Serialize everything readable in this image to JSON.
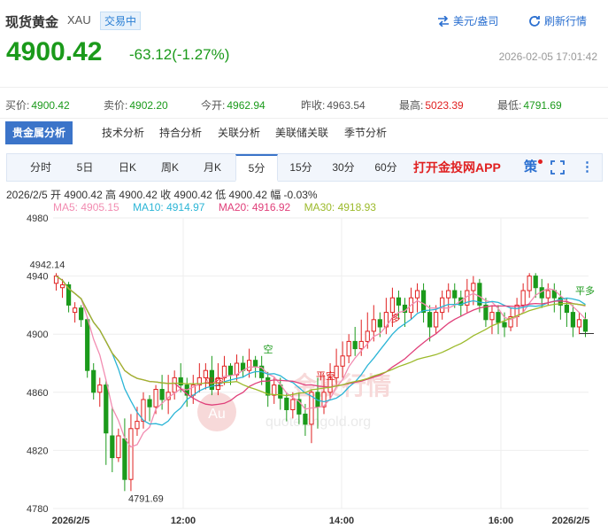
{
  "header": {
    "title": "现货黄金",
    "symbol": "XAU",
    "status": "交易中",
    "currency_link": "美元/盎司",
    "refresh_link": "刷新行情",
    "price": "4900.42",
    "change": "-63.12(-1.27%)",
    "timestamp": "2026-02-05 17:01:42"
  },
  "quotes": [
    {
      "label": "买价:",
      "value": "4900.42",
      "color": "green"
    },
    {
      "label": "卖价:",
      "value": "4902.20",
      "color": "green"
    },
    {
      "label": "今开:",
      "value": "4962.94",
      "color": "green"
    },
    {
      "label": "昨收:",
      "value": "4963.54",
      "color": "neutral"
    },
    {
      "label": "最高:",
      "value": "5023.39",
      "color": "red"
    },
    {
      "label": "最低:",
      "value": "4791.69",
      "color": "green"
    }
  ],
  "analysis_tabs": [
    "贵金属分析",
    "技术分析",
    "持合分析",
    "关联分析",
    "美联储关联",
    "季节分析"
  ],
  "period_tabs": [
    "分时",
    "5日",
    "日K",
    "周K",
    "月K",
    "5分",
    "15分",
    "30分",
    "60分"
  ],
  "active_period": "5分",
  "app_banner": "打开金投网APP",
  "strategy_label": "策",
  "ohlc_info": "2026/2/5  开 4900.42  高 4900.42  收 4900.42  低 4900.42  幅 -0.03%",
  "ma_legend": [
    {
      "label": "MA5: 4905.15",
      "color": "#f28cb1"
    },
    {
      "label": "MA10: 4914.97",
      "color": "#2bb5d6"
    },
    {
      "label": "MA20: 4916.92",
      "color": "#e0407a"
    },
    {
      "label": "MA30: 4918.93",
      "color": "#9cba2b"
    }
  ],
  "chart_data": {
    "type": "candlestick",
    "ylim": [
      4780,
      4980
    ],
    "y_ticks": [
      "4980",
      "4940",
      "4900",
      "4860",
      "4820",
      "4780"
    ],
    "x_ticks": [
      "2026/2/5",
      "12:00",
      "14:00",
      "16:00",
      "2026/2/5"
    ],
    "annotations": [
      "4942.14",
      "4791.69"
    ],
    "signals": [
      "平空",
      "空",
      "平空",
      "多",
      "平多"
    ],
    "watermark": [
      "金投行情",
      "quote.cngold.org",
      "Au"
    ],
    "candles": [
      [
        4935,
        4940,
        4930,
        4942
      ],
      [
        4932,
        4934,
        4925,
        4938
      ],
      [
        4934,
        4920,
        4915,
        4936
      ],
      [
        4915,
        4918,
        4908,
        4922
      ],
      [
        4918,
        4910,
        4905,
        4920
      ],
      [
        4910,
        4875,
        4870,
        4912
      ],
      [
        4875,
        4860,
        4855,
        4880
      ],
      [
        4860,
        4865,
        4850,
        4870
      ],
      [
        4865,
        4832,
        4810,
        4868
      ],
      [
        4830,
        4815,
        4805,
        4850
      ],
      [
        4815,
        4830,
        4812,
        4835
      ],
      [
        4828,
        4800,
        4792,
        4842
      ],
      [
        4800,
        4835,
        4792,
        4845
      ],
      [
        4835,
        4840,
        4830,
        4850
      ],
      [
        4840,
        4855,
        4835,
        4860
      ],
      [
        4855,
        4850,
        4840,
        4858
      ],
      [
        4850,
        4862,
        4845,
        4865
      ],
      [
        4862,
        4855,
        4848,
        4872
      ],
      [
        4855,
        4860,
        4845,
        4872
      ],
      [
        4860,
        4870,
        4855,
        4875
      ],
      [
        4870,
        4865,
        4860,
        4880
      ],
      [
        4865,
        4858,
        4850,
        4870
      ],
      [
        4858,
        4865,
        4852,
        4872
      ],
      [
        4865,
        4870,
        4860,
        4880
      ],
      [
        4870,
        4875,
        4862,
        4880
      ],
      [
        4875,
        4862,
        4858,
        4885
      ],
      [
        4862,
        4870,
        4858,
        4880
      ],
      [
        4870,
        4878,
        4865,
        4885
      ],
      [
        4878,
        4872,
        4865,
        4880
      ],
      [
        4872,
        4880,
        4868,
        4886
      ],
      [
        4880,
        4875,
        4870,
        4885
      ],
      [
        4875,
        4882,
        4870,
        4890
      ],
      [
        4882,
        4878,
        4870,
        4885
      ],
      [
        4878,
        4870,
        4865,
        4885
      ],
      [
        4870,
        4858,
        4850,
        4874
      ],
      [
        4858,
        4865,
        4852,
        4870
      ],
      [
        4865,
        4856,
        4848,
        4870
      ],
      [
        4856,
        4848,
        4840,
        4860
      ],
      [
        4848,
        4855,
        4842,
        4860
      ],
      [
        4855,
        4845,
        4838,
        4860
      ],
      [
        4845,
        4838,
        4830,
        4852
      ],
      [
        4838,
        4860,
        4825,
        4862
      ],
      [
        4860,
        4850,
        4835,
        4870
      ],
      [
        4850,
        4860,
        4845,
        4872
      ],
      [
        4860,
        4870,
        4855,
        4880
      ],
      [
        4870,
        4878,
        4865,
        4890
      ],
      [
        4878,
        4885,
        4870,
        4895
      ],
      [
        4885,
        4895,
        4880,
        4900
      ],
      [
        4895,
        4890,
        4885,
        4905
      ],
      [
        4890,
        4895,
        4885,
        4910
      ],
      [
        4895,
        4902,
        4890,
        4915
      ],
      [
        4902,
        4910,
        4895,
        4920
      ],
      [
        4910,
        4905,
        4898,
        4915
      ],
      [
        4905,
        4915,
        4900,
        4925
      ],
      [
        4915,
        4925,
        4905,
        4932
      ],
      [
        4925,
        4920,
        4910,
        4930
      ],
      [
        4920,
        4915,
        4905,
        4925
      ],
      [
        4915,
        4925,
        4910,
        4932
      ],
      [
        4925,
        4930,
        4915,
        4935
      ],
      [
        4930,
        4915,
        4908,
        4935
      ],
      [
        4915,
        4905,
        4895,
        4920
      ],
      [
        4905,
        4915,
        4900,
        4920
      ],
      [
        4915,
        4925,
        4910,
        4930
      ],
      [
        4925,
        4930,
        4915,
        4935
      ],
      [
        4930,
        4925,
        4918,
        4935
      ],
      [
        4925,
        4920,
        4912,
        4930
      ],
      [
        4920,
        4930,
        4915,
        4938
      ],
      [
        4930,
        4935,
        4920,
        4940
      ],
      [
        4935,
        4920,
        4915,
        4938
      ],
      [
        4920,
        4910,
        4905,
        4925
      ],
      [
        4910,
        4915,
        4900,
        4920
      ],
      [
        4915,
        4908,
        4900,
        4920
      ],
      [
        4908,
        4905,
        4898,
        4915
      ],
      [
        4905,
        4912,
        4902,
        4918
      ],
      [
        4912,
        4920,
        4905,
        4925
      ],
      [
        4920,
        4930,
        4915,
        4935
      ],
      [
        4930,
        4940,
        4925,
        4942
      ],
      [
        4940,
        4932,
        4925,
        4942
      ],
      [
        4932,
        4925,
        4918,
        4938
      ],
      [
        4925,
        4930,
        4920,
        4935
      ],
      [
        4930,
        4925,
        4915,
        4935
      ],
      [
        4925,
        4920,
        4910,
        4930
      ],
      [
        4920,
        4915,
        4905,
        4925
      ],
      [
        4915,
        4905,
        4898,
        4920
      ],
      [
        4905,
        4910,
        4900,
        4915
      ],
      [
        4910,
        4902,
        4898,
        4915
      ]
    ]
  }
}
